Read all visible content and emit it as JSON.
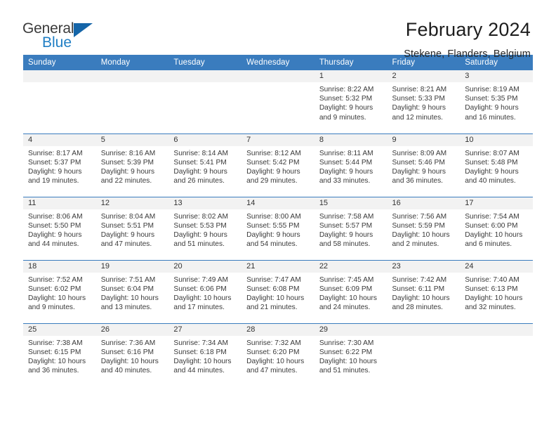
{
  "brand": {
    "name_part1": "General",
    "name_part2": "Blue",
    "accent_color": "#1f7ec4",
    "triangle_color": "#1565a8"
  },
  "header": {
    "title": "February 2024",
    "subtitle": "Stekene, Flanders, Belgium"
  },
  "calendar": {
    "header_bg": "#3a7cbe",
    "daynum_bg": "#f2f2f2",
    "weekday_headers": [
      "Sunday",
      "Monday",
      "Tuesday",
      "Wednesday",
      "Thursday",
      "Friday",
      "Saturday"
    ],
    "weeks": [
      [
        {
          "day": "",
          "empty": true,
          "sunrise": "",
          "sunset": "",
          "daylight1": "",
          "daylight2": ""
        },
        {
          "day": "",
          "empty": true,
          "sunrise": "",
          "sunset": "",
          "daylight1": "",
          "daylight2": ""
        },
        {
          "day": "",
          "empty": true,
          "sunrise": "",
          "sunset": "",
          "daylight1": "",
          "daylight2": ""
        },
        {
          "day": "",
          "empty": true,
          "sunrise": "",
          "sunset": "",
          "daylight1": "",
          "daylight2": ""
        },
        {
          "day": "1",
          "empty": false,
          "sunrise": "Sunrise: 8:22 AM",
          "sunset": "Sunset: 5:32 PM",
          "daylight1": "Daylight: 9 hours",
          "daylight2": "and 9 minutes."
        },
        {
          "day": "2",
          "empty": false,
          "sunrise": "Sunrise: 8:21 AM",
          "sunset": "Sunset: 5:33 PM",
          "daylight1": "Daylight: 9 hours",
          "daylight2": "and 12 minutes."
        },
        {
          "day": "3",
          "empty": false,
          "sunrise": "Sunrise: 8:19 AM",
          "sunset": "Sunset: 5:35 PM",
          "daylight1": "Daylight: 9 hours",
          "daylight2": "and 16 minutes."
        }
      ],
      [
        {
          "day": "4",
          "empty": false,
          "sunrise": "Sunrise: 8:17 AM",
          "sunset": "Sunset: 5:37 PM",
          "daylight1": "Daylight: 9 hours",
          "daylight2": "and 19 minutes."
        },
        {
          "day": "5",
          "empty": false,
          "sunrise": "Sunrise: 8:16 AM",
          "sunset": "Sunset: 5:39 PM",
          "daylight1": "Daylight: 9 hours",
          "daylight2": "and 22 minutes."
        },
        {
          "day": "6",
          "empty": false,
          "sunrise": "Sunrise: 8:14 AM",
          "sunset": "Sunset: 5:41 PM",
          "daylight1": "Daylight: 9 hours",
          "daylight2": "and 26 minutes."
        },
        {
          "day": "7",
          "empty": false,
          "sunrise": "Sunrise: 8:12 AM",
          "sunset": "Sunset: 5:42 PM",
          "daylight1": "Daylight: 9 hours",
          "daylight2": "and 29 minutes."
        },
        {
          "day": "8",
          "empty": false,
          "sunrise": "Sunrise: 8:11 AM",
          "sunset": "Sunset: 5:44 PM",
          "daylight1": "Daylight: 9 hours",
          "daylight2": "and 33 minutes."
        },
        {
          "day": "9",
          "empty": false,
          "sunrise": "Sunrise: 8:09 AM",
          "sunset": "Sunset: 5:46 PM",
          "daylight1": "Daylight: 9 hours",
          "daylight2": "and 36 minutes."
        },
        {
          "day": "10",
          "empty": false,
          "sunrise": "Sunrise: 8:07 AM",
          "sunset": "Sunset: 5:48 PM",
          "daylight1": "Daylight: 9 hours",
          "daylight2": "and 40 minutes."
        }
      ],
      [
        {
          "day": "11",
          "empty": false,
          "sunrise": "Sunrise: 8:06 AM",
          "sunset": "Sunset: 5:50 PM",
          "daylight1": "Daylight: 9 hours",
          "daylight2": "and 44 minutes."
        },
        {
          "day": "12",
          "empty": false,
          "sunrise": "Sunrise: 8:04 AM",
          "sunset": "Sunset: 5:51 PM",
          "daylight1": "Daylight: 9 hours",
          "daylight2": "and 47 minutes."
        },
        {
          "day": "13",
          "empty": false,
          "sunrise": "Sunrise: 8:02 AM",
          "sunset": "Sunset: 5:53 PM",
          "daylight1": "Daylight: 9 hours",
          "daylight2": "and 51 minutes."
        },
        {
          "day": "14",
          "empty": false,
          "sunrise": "Sunrise: 8:00 AM",
          "sunset": "Sunset: 5:55 PM",
          "daylight1": "Daylight: 9 hours",
          "daylight2": "and 54 minutes."
        },
        {
          "day": "15",
          "empty": false,
          "sunrise": "Sunrise: 7:58 AM",
          "sunset": "Sunset: 5:57 PM",
          "daylight1": "Daylight: 9 hours",
          "daylight2": "and 58 minutes."
        },
        {
          "day": "16",
          "empty": false,
          "sunrise": "Sunrise: 7:56 AM",
          "sunset": "Sunset: 5:59 PM",
          "daylight1": "Daylight: 10 hours",
          "daylight2": "and 2 minutes."
        },
        {
          "day": "17",
          "empty": false,
          "sunrise": "Sunrise: 7:54 AM",
          "sunset": "Sunset: 6:00 PM",
          "daylight1": "Daylight: 10 hours",
          "daylight2": "and 6 minutes."
        }
      ],
      [
        {
          "day": "18",
          "empty": false,
          "sunrise": "Sunrise: 7:52 AM",
          "sunset": "Sunset: 6:02 PM",
          "daylight1": "Daylight: 10 hours",
          "daylight2": "and 9 minutes."
        },
        {
          "day": "19",
          "empty": false,
          "sunrise": "Sunrise: 7:51 AM",
          "sunset": "Sunset: 6:04 PM",
          "daylight1": "Daylight: 10 hours",
          "daylight2": "and 13 minutes."
        },
        {
          "day": "20",
          "empty": false,
          "sunrise": "Sunrise: 7:49 AM",
          "sunset": "Sunset: 6:06 PM",
          "daylight1": "Daylight: 10 hours",
          "daylight2": "and 17 minutes."
        },
        {
          "day": "21",
          "empty": false,
          "sunrise": "Sunrise: 7:47 AM",
          "sunset": "Sunset: 6:08 PM",
          "daylight1": "Daylight: 10 hours",
          "daylight2": "and 21 minutes."
        },
        {
          "day": "22",
          "empty": false,
          "sunrise": "Sunrise: 7:45 AM",
          "sunset": "Sunset: 6:09 PM",
          "daylight1": "Daylight: 10 hours",
          "daylight2": "and 24 minutes."
        },
        {
          "day": "23",
          "empty": false,
          "sunrise": "Sunrise: 7:42 AM",
          "sunset": "Sunset: 6:11 PM",
          "daylight1": "Daylight: 10 hours",
          "daylight2": "and 28 minutes."
        },
        {
          "day": "24",
          "empty": false,
          "sunrise": "Sunrise: 7:40 AM",
          "sunset": "Sunset: 6:13 PM",
          "daylight1": "Daylight: 10 hours",
          "daylight2": "and 32 minutes."
        }
      ],
      [
        {
          "day": "25",
          "empty": false,
          "sunrise": "Sunrise: 7:38 AM",
          "sunset": "Sunset: 6:15 PM",
          "daylight1": "Daylight: 10 hours",
          "daylight2": "and 36 minutes."
        },
        {
          "day": "26",
          "empty": false,
          "sunrise": "Sunrise: 7:36 AM",
          "sunset": "Sunset: 6:16 PM",
          "daylight1": "Daylight: 10 hours",
          "daylight2": "and 40 minutes."
        },
        {
          "day": "27",
          "empty": false,
          "sunrise": "Sunrise: 7:34 AM",
          "sunset": "Sunset: 6:18 PM",
          "daylight1": "Daylight: 10 hours",
          "daylight2": "and 44 minutes."
        },
        {
          "day": "28",
          "empty": false,
          "sunrise": "Sunrise: 7:32 AM",
          "sunset": "Sunset: 6:20 PM",
          "daylight1": "Daylight: 10 hours",
          "daylight2": "and 47 minutes."
        },
        {
          "day": "29",
          "empty": false,
          "sunrise": "Sunrise: 7:30 AM",
          "sunset": "Sunset: 6:22 PM",
          "daylight1": "Daylight: 10 hours",
          "daylight2": "and 51 minutes."
        },
        {
          "day": "",
          "empty": true,
          "sunrise": "",
          "sunset": "",
          "daylight1": "",
          "daylight2": ""
        },
        {
          "day": "",
          "empty": true,
          "sunrise": "",
          "sunset": "",
          "daylight1": "",
          "daylight2": ""
        }
      ]
    ]
  }
}
